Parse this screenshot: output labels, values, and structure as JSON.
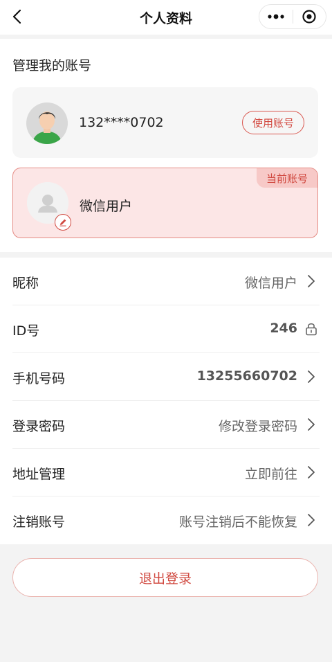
{
  "nav": {
    "title": "个人资料",
    "back_icon": "chevron-left-icon",
    "more_icon": "more-dots-icon",
    "target_icon": "target-icon"
  },
  "account_section": {
    "title": "管理我的账号",
    "other_account": {
      "phone": "132****0702",
      "use_button": "使用账号"
    },
    "current_account": {
      "badge": "当前账号",
      "name": "微信用户"
    }
  },
  "info_rows": [
    {
      "label": "昵称",
      "value": "微信用户",
      "icon": "chevron-right-icon"
    },
    {
      "label": "ID号",
      "value": "246",
      "icon": "lock-icon"
    },
    {
      "label": "手机号码",
      "value": "13255660702",
      "icon": "chevron-right-icon"
    },
    {
      "label": "登录密码",
      "value": "修改登录密码",
      "icon": "chevron-right-icon"
    },
    {
      "label": "地址管理",
      "value": "立即前往",
      "icon": "chevron-right-icon"
    },
    {
      "label": "注销账号",
      "value": "账号注销后不能恢复",
      "icon": "chevron-right-icon"
    }
  ],
  "logout": {
    "label": "退出登录"
  },
  "colors": {
    "accent": "#d0483f",
    "current_bg": "#fce6e6",
    "page_bg": "#f3f3f3"
  }
}
